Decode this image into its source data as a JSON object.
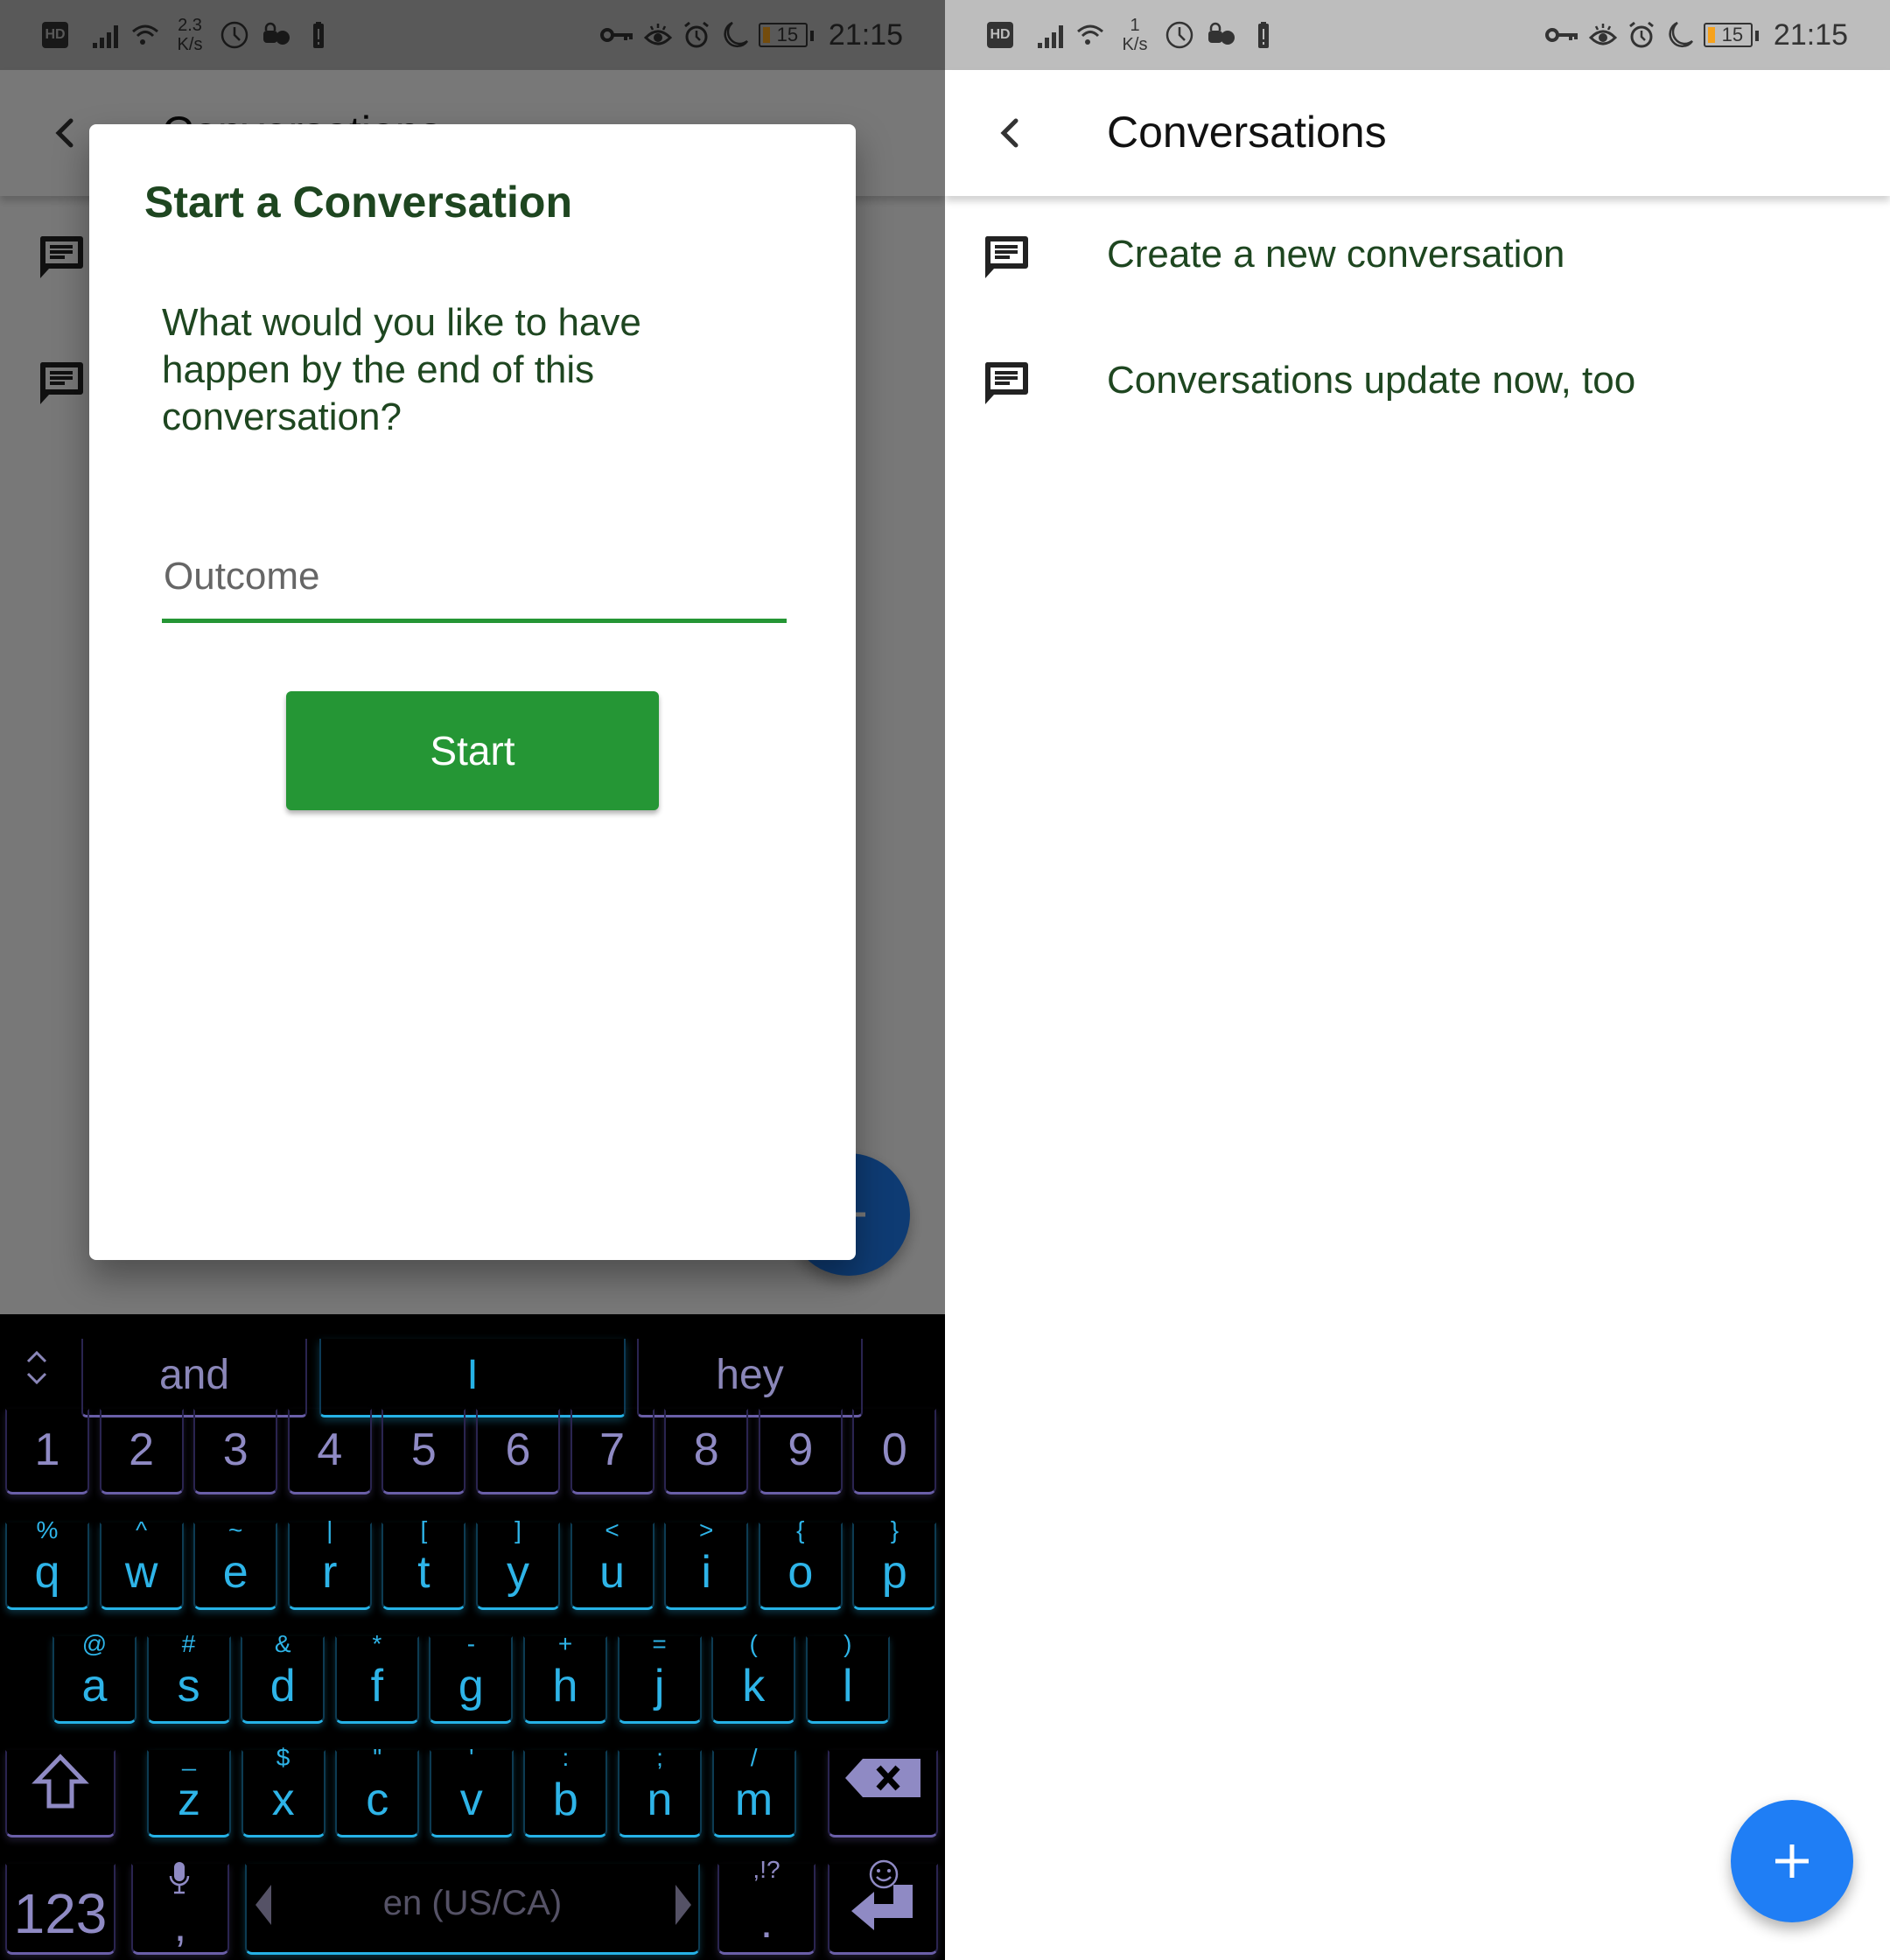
{
  "status_bar": {
    "left": {
      "network_speed_value": "2.3",
      "network_speed_unit": "K/s",
      "battery_percent": "15",
      "time": "21:15"
    },
    "right": {
      "network_speed_value": "1",
      "network_speed_unit": "K/s",
      "battery_percent": "15",
      "time": "21:15"
    },
    "icons": [
      "hd-icon",
      "signal-icon",
      "wifi-icon",
      "clock-icon",
      "privacy-icon",
      "battery-alert-icon",
      "key-icon",
      "eye-icon",
      "alarm-icon",
      "moon-icon",
      "battery-icon"
    ]
  },
  "app": {
    "title": "Conversations",
    "conversations": [
      {
        "label": "Create a new conversation",
        "icon": "chat-icon"
      },
      {
        "label": "Conversations update now, too",
        "icon": "chat-icon"
      }
    ],
    "fab_icon": "plus-icon",
    "colors": {
      "accent_green": "#259635",
      "text_green": "#1e4620",
      "fab_blue": "#1f7ef5"
    }
  },
  "dialog": {
    "title": "Start a Conversation",
    "question": "What would you like to have happen by the end of this conversation?",
    "outcome_placeholder": "Outcome",
    "outcome_value": "",
    "start_label": "Start"
  },
  "keyboard": {
    "suggestions": [
      "and",
      "I",
      "hey"
    ],
    "number_row": [
      "1",
      "2",
      "3",
      "4",
      "5",
      "6",
      "7",
      "8",
      "9",
      "0"
    ],
    "row1": [
      {
        "main": "q",
        "alt": "%"
      },
      {
        "main": "w",
        "alt": "^"
      },
      {
        "main": "e",
        "alt": "~"
      },
      {
        "main": "r",
        "alt": "|"
      },
      {
        "main": "t",
        "alt": "["
      },
      {
        "main": "y",
        "alt": "]"
      },
      {
        "main": "u",
        "alt": "<"
      },
      {
        "main": "i",
        "alt": ">"
      },
      {
        "main": "o",
        "alt": "{"
      },
      {
        "main": "p",
        "alt": "}"
      }
    ],
    "row2": [
      {
        "main": "a",
        "alt": "@"
      },
      {
        "main": "s",
        "alt": "#"
      },
      {
        "main": "d",
        "alt": "&"
      },
      {
        "main": "f",
        "alt": "*"
      },
      {
        "main": "g",
        "alt": "-"
      },
      {
        "main": "h",
        "alt": "+"
      },
      {
        "main": "j",
        "alt": "="
      },
      {
        "main": "k",
        "alt": "("
      },
      {
        "main": "l",
        "alt": ")"
      }
    ],
    "row3": [
      {
        "main": "z",
        "alt": "_"
      },
      {
        "main": "x",
        "alt": "$"
      },
      {
        "main": "c",
        "alt": "\""
      },
      {
        "main": "v",
        "alt": "'"
      },
      {
        "main": "b",
        "alt": ":"
      },
      {
        "main": "n",
        "alt": ";"
      },
      {
        "main": "m",
        "alt": "/"
      }
    ],
    "symbols_label": "123",
    "comma_label": ",",
    "space_label": "en (US/CA)",
    "period_label": ".",
    "period_alt": ",!?"
  }
}
